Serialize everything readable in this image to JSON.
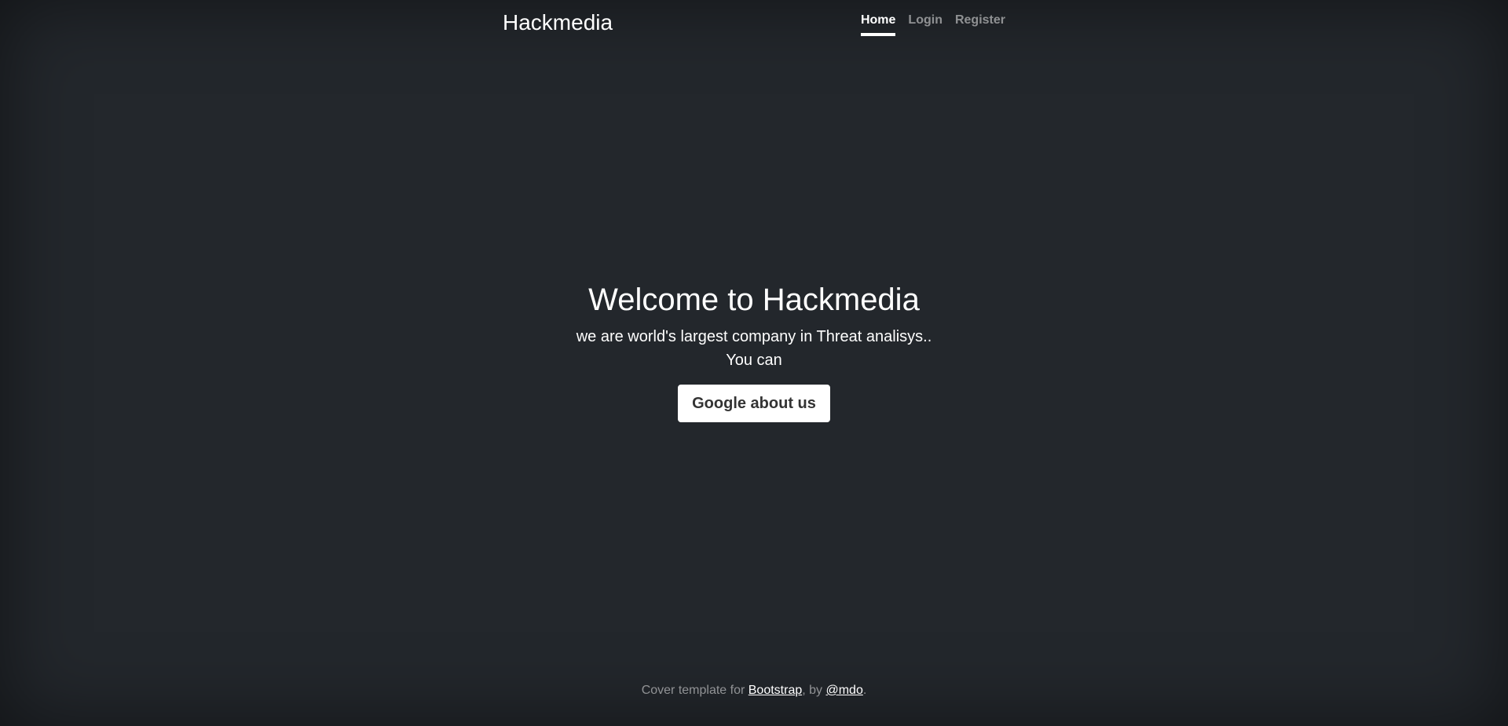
{
  "header": {
    "brand": "Hackmedia",
    "nav": [
      {
        "label": "Home",
        "active": true
      },
      {
        "label": "Login",
        "active": false
      },
      {
        "label": "Register",
        "active": false
      }
    ]
  },
  "main": {
    "heading": "Welcome to Hackmedia",
    "lead_line1": "we are world's largest company in Threat analisys..",
    "lead_line2": "You can",
    "button_label": "Google about us"
  },
  "footer": {
    "text_prefix": "Cover template for ",
    "link1": "Bootstrap",
    "text_middle": ", by ",
    "link2": "@mdo",
    "text_suffix": "."
  },
  "colors": {
    "background": "#23272c",
    "text": "#ffffff",
    "muted": "rgba(255,255,255,0.5)",
    "button_text": "#333333"
  }
}
